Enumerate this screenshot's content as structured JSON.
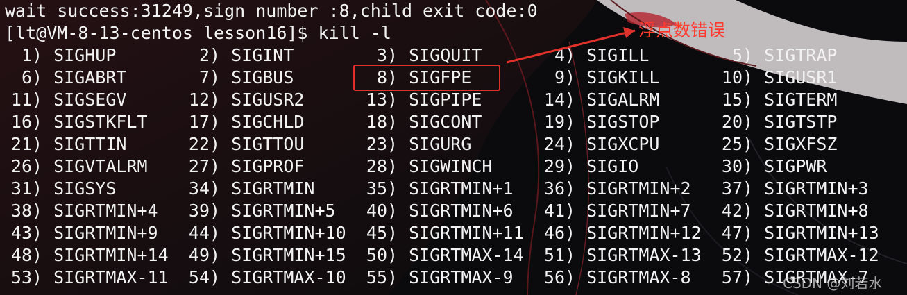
{
  "terminal": {
    "lines": [
      "wait success:31249,sign number :8,child exit code:0",
      "[lt@VM-8-13-centos lesson16]$ kill -l"
    ],
    "signals": [
      {
        "num": "1",
        "name": "SIGHUP"
      },
      {
        "num": "2",
        "name": "SIGINT"
      },
      {
        "num": "3",
        "name": "SIGQUIT"
      },
      {
        "num": "4",
        "name": "SIGILL"
      },
      {
        "num": "5",
        "name": "SIGTRAP"
      },
      {
        "num": "6",
        "name": "SIGABRT"
      },
      {
        "num": "7",
        "name": "SIGBUS"
      },
      {
        "num": "8",
        "name": "SIGFPE"
      },
      {
        "num": "9",
        "name": "SIGKILL"
      },
      {
        "num": "10",
        "name": "SIGUSR1"
      },
      {
        "num": "11",
        "name": "SIGSEGV"
      },
      {
        "num": "12",
        "name": "SIGUSR2"
      },
      {
        "num": "13",
        "name": "SIGPIPE"
      },
      {
        "num": "14",
        "name": "SIGALRM"
      },
      {
        "num": "15",
        "name": "SIGTERM"
      },
      {
        "num": "16",
        "name": "SIGSTKFLT"
      },
      {
        "num": "17",
        "name": "SIGCHLD"
      },
      {
        "num": "18",
        "name": "SIGCONT"
      },
      {
        "num": "19",
        "name": "SIGSTOP"
      },
      {
        "num": "20",
        "name": "SIGTSTP"
      },
      {
        "num": "21",
        "name": "SIGTTIN"
      },
      {
        "num": "22",
        "name": "SIGTTOU"
      },
      {
        "num": "23",
        "name": "SIGURG"
      },
      {
        "num": "24",
        "name": "SIGXCPU"
      },
      {
        "num": "25",
        "name": "SIGXFSZ"
      },
      {
        "num": "26",
        "name": "SIGVTALRM"
      },
      {
        "num": "27",
        "name": "SIGPROF"
      },
      {
        "num": "28",
        "name": "SIGWINCH"
      },
      {
        "num": "29",
        "name": "SIGIO"
      },
      {
        "num": "30",
        "name": "SIGPWR"
      },
      {
        "num": "31",
        "name": "SIGSYS"
      },
      {
        "num": "34",
        "name": "SIGRTMIN"
      },
      {
        "num": "35",
        "name": "SIGRTMIN+1"
      },
      {
        "num": "36",
        "name": "SIGRTMIN+2"
      },
      {
        "num": "37",
        "name": "SIGRTMIN+3"
      },
      {
        "num": "38",
        "name": "SIGRTMIN+4"
      },
      {
        "num": "39",
        "name": "SIGRTMIN+5"
      },
      {
        "num": "40",
        "name": "SIGRTMIN+6"
      },
      {
        "num": "41",
        "name": "SIGRTMIN+7"
      },
      {
        "num": "42",
        "name": "SIGRTMIN+8"
      },
      {
        "num": "43",
        "name": "SIGRTMIN+9"
      },
      {
        "num": "44",
        "name": "SIGRTMIN+10"
      },
      {
        "num": "45",
        "name": "SIGRTMIN+11"
      },
      {
        "num": "46",
        "name": "SIGRTMIN+12"
      },
      {
        "num": "47",
        "name": "SIGRTMIN+13"
      },
      {
        "num": "48",
        "name": "SIGRTMIN+14"
      },
      {
        "num": "49",
        "name": "SIGRTMIN+15"
      },
      {
        "num": "50",
        "name": "SIGRTMAX-14"
      },
      {
        "num": "51",
        "name": "SIGRTMAX-13"
      },
      {
        "num": "52",
        "name": "SIGRTMAX-12"
      },
      {
        "num": "53",
        "name": "SIGRTMAX-11"
      },
      {
        "num": "54",
        "name": "SIGRTMAX-10"
      },
      {
        "num": "55",
        "name": "SIGRTMAX-9"
      },
      {
        "num": "56",
        "name": "SIGRTMAX-8"
      },
      {
        "num": "57",
        "name": "SIGRTMAX-7"
      }
    ],
    "highlighted_signal": "8"
  },
  "annotation": {
    "text": "浮点数错误",
    "color": "#ff3b2f"
  },
  "watermark": "CSDN @刘若水",
  "colors": {
    "background": "#0b0b0d",
    "text": "#f2f2f2",
    "highlight": "#e0302a"
  }
}
